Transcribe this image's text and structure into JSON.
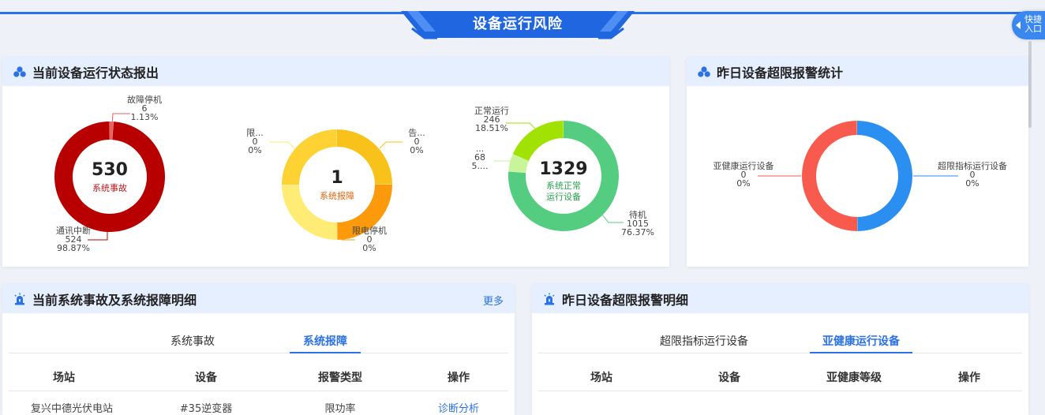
{
  "banner": {
    "title": "设备运行风险"
  },
  "quick_entry": {
    "label_line1": "快捷",
    "label_line2": "入口"
  },
  "colors": {
    "accent": "#2a72e5",
    "header_bg": "#e6efff"
  },
  "panels": {
    "status": {
      "title": "当前设备运行状态报出",
      "icon": "cluster-icon"
    },
    "overlimit_stats": {
      "title": "昨日设备超限报警统计",
      "icon": "cluster-icon"
    },
    "faults": {
      "title": "当前系统事故及系统报障明细",
      "icon": "alarm-light-icon",
      "more": "更多"
    },
    "overlimit_detail": {
      "title": "昨日设备超限报警明细",
      "icon": "alarm-light-icon"
    }
  },
  "chart_data": [
    {
      "type": "pie",
      "center_value": "530",
      "center_label": "系统事故",
      "slices": [
        {
          "name": "故障停机",
          "value": 6,
          "percent": "1.13%",
          "color": "#e9605e"
        },
        {
          "name": "通讯中断",
          "value": 524,
          "percent": "98.87%",
          "color": "#b80000"
        }
      ]
    },
    {
      "type": "pie",
      "center_value": "1",
      "center_label": "系统报障",
      "slices": [
        {
          "name": "告...",
          "value": 0,
          "percent": "0%",
          "color": "#f9c21a",
          "share": 0.25
        },
        {
          "name": "限电停机",
          "value": 0,
          "percent": "0%",
          "color": "#fc9a0c",
          "share": 0.25
        },
        {
          "name": "限...",
          "value": 0,
          "percent": "0%",
          "color": "#ffec75",
          "share": 0.25
        },
        {
          "name": "",
          "value": 0,
          "percent": "",
          "color": "#fdd232",
          "share": 0.25
        }
      ]
    },
    {
      "type": "pie",
      "center_value": "1329",
      "center_label_line1": "系统正常",
      "center_label_line2": "运行设备",
      "slices": [
        {
          "name": "待机",
          "value": 1015,
          "percent": "76.37%",
          "color": "#55cd80"
        },
        {
          "name": "...",
          "value": 68,
          "percent": "5....",
          "color": "#c8f59a"
        },
        {
          "name": "正常运行",
          "value": 246,
          "percent": "18.51%",
          "color": "#a2e203"
        }
      ]
    },
    {
      "type": "pie",
      "slices": [
        {
          "name": "超限指标运行设备",
          "value": 0,
          "percent": "0%",
          "color": "#2a8ff0",
          "share": 0.5
        },
        {
          "name": "亚健康运行设备",
          "value": 0,
          "percent": "0%",
          "color": "#f85a4e",
          "share": 0.5
        }
      ]
    }
  ],
  "faults_table": {
    "tabs": [
      "系统事故",
      "系统报障"
    ],
    "active_tab": 1,
    "columns": [
      "场站",
      "设备",
      "报警类型",
      "操作"
    ],
    "rows": [
      {
        "station": "复兴中德光伏电站",
        "device": "#35逆变器",
        "alarm_type": "限功率",
        "action": "诊断分析"
      }
    ]
  },
  "overlimit_table": {
    "tabs": [
      "超限指标运行设备",
      "亚健康运行设备"
    ],
    "active_tab": 1,
    "columns": [
      "场站",
      "设备",
      "亚健康等级",
      "操作"
    ]
  }
}
